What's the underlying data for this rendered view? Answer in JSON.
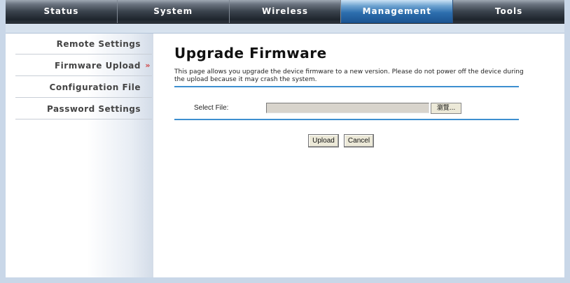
{
  "nav": {
    "tabs": [
      {
        "label": "Status",
        "active": false
      },
      {
        "label": "System",
        "active": false
      },
      {
        "label": "Wireless",
        "active": false
      },
      {
        "label": "Management",
        "active": true
      },
      {
        "label": "Tools",
        "active": false
      }
    ]
  },
  "sidebar": {
    "items": [
      {
        "label": "Remote Settings",
        "active": false
      },
      {
        "label": "Firmware Upload",
        "active": true,
        "indicator": "»"
      },
      {
        "label": "Configuration File",
        "active": false
      },
      {
        "label": "Password Settings",
        "active": false
      }
    ]
  },
  "main": {
    "title": "Upgrade Firmware",
    "description": "This page allows you upgrade the device firmware to a new version. Please do not power off the device during the upload because it may crash the system.",
    "select_file_label": "Select File:",
    "file_value": "",
    "browse_label": "瀏覽...",
    "upload_label": "Upload",
    "cancel_label": "Cancel"
  },
  "colors": {
    "accent": "#3d8fd0",
    "active_tab": "#2d6fae",
    "page_bg": "#c9d7e8"
  }
}
